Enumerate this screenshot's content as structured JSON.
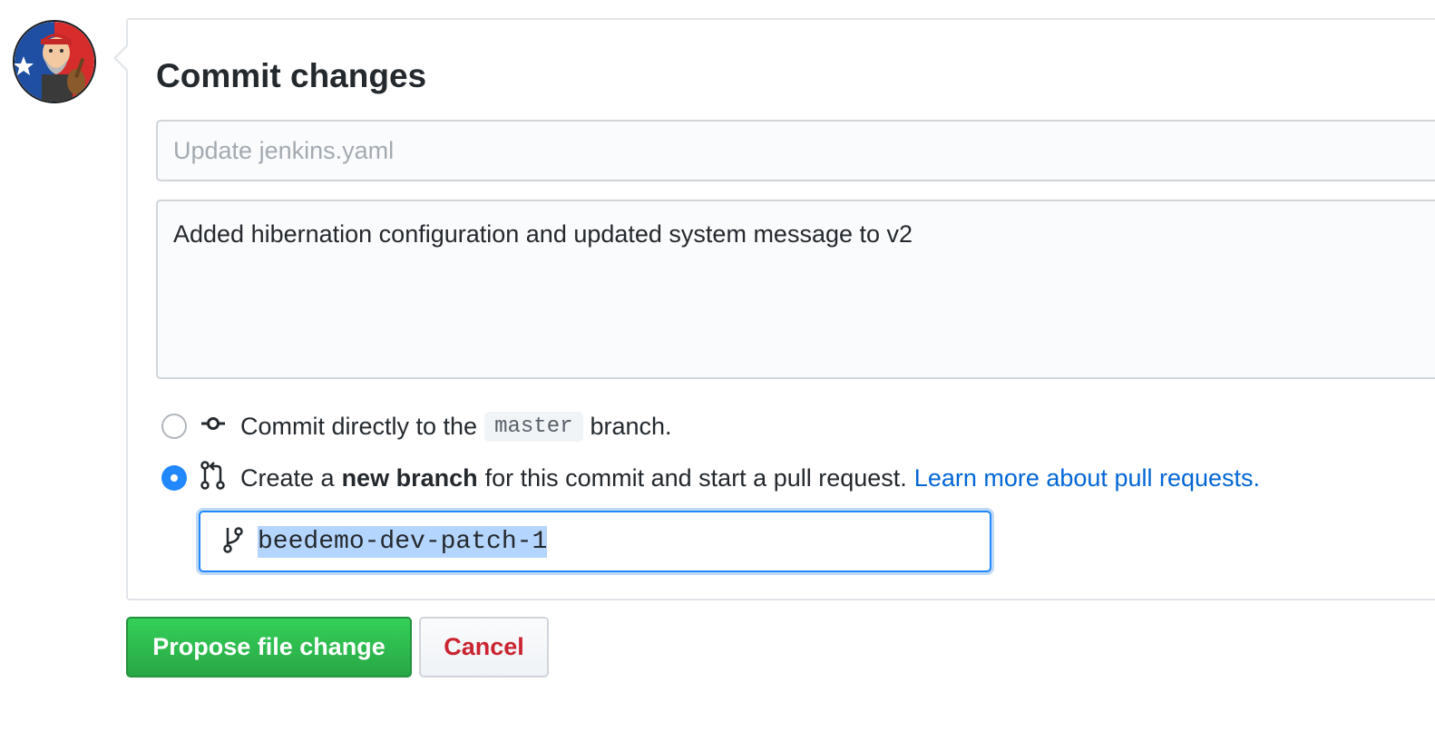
{
  "avatar": {
    "icon": "user-avatar-icon",
    "alt": "User avatar"
  },
  "commit": {
    "title": "Commit changes",
    "summary_placeholder": "Update jenkins.yaml",
    "summary_value": "",
    "description_value": "Added hibernation configuration and updated system message to v2"
  },
  "options": {
    "direct": {
      "selected": false,
      "icon": "git-commit-icon",
      "text_before": "Commit directly to the",
      "branch_name": "master",
      "text_after": "branch."
    },
    "new_branch": {
      "selected": true,
      "icon": "git-pull-request-icon",
      "text_before": "Create a",
      "text_bold": "new branch",
      "text_after": "for this commit and start a pull request.",
      "link_text": "Learn more about pull requests."
    }
  },
  "branch_input": {
    "icon": "git-branch-icon",
    "value": "beedemo-dev-patch-1"
  },
  "buttons": {
    "propose_label": "Propose file change",
    "cancel_label": "Cancel"
  },
  "colors": {
    "primary_green": "#28a745",
    "cancel_red": "#cb2431",
    "link_blue": "#0366d6",
    "focus_blue": "#2188ff"
  }
}
